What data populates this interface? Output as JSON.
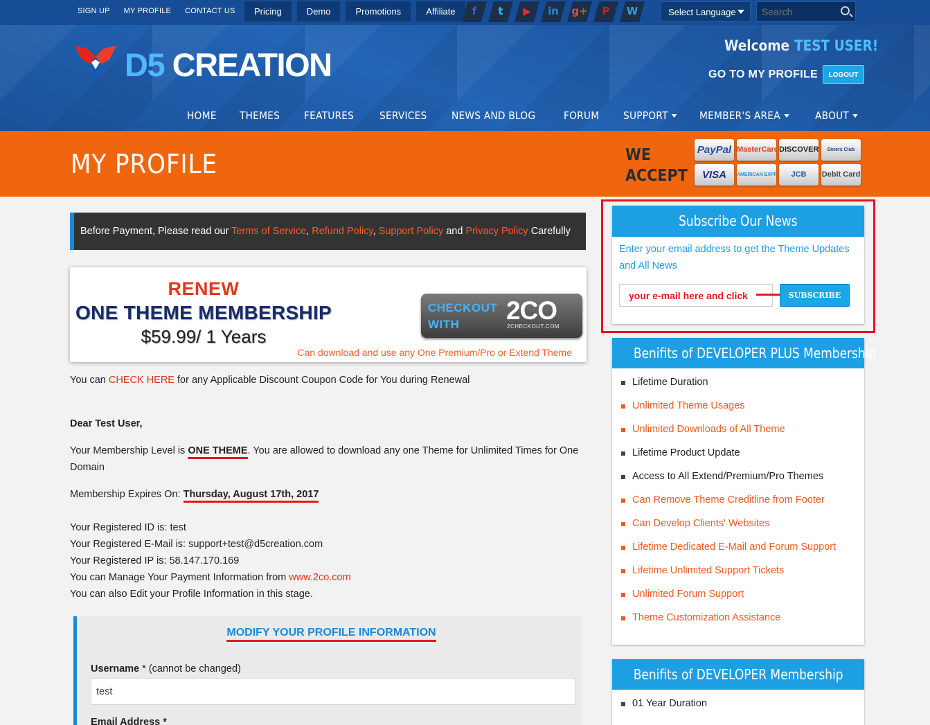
{
  "topbar": {
    "links": [
      "SIGN UP",
      "MY PROFILE",
      "CONTACT US"
    ],
    "buttons": [
      "Pricing",
      "Demo",
      "Promotions",
      "Affiliate"
    ],
    "social": [
      {
        "icon": "facebook-icon",
        "glyph": "f",
        "color": "#3b5ccc"
      },
      {
        "icon": "twitter-icon",
        "glyph": "t",
        "color": "#3fb4f2"
      },
      {
        "icon": "youtube-icon",
        "glyph": "▶",
        "color": "#e52d27"
      },
      {
        "icon": "linkedin-icon",
        "glyph": "in",
        "color": "#2a88c9"
      },
      {
        "icon": "google-plus-icon",
        "glyph": "g+",
        "color": "#dd4b39"
      },
      {
        "icon": "pinterest-icon",
        "glyph": "P",
        "color": "#cb2027"
      },
      {
        "icon": "wordpress-icon",
        "glyph": "W",
        "color": "#3d9ad1"
      }
    ],
    "language_label": "Select Language",
    "search_placeholder": "Search"
  },
  "header": {
    "logo_d5": "D5",
    "logo_creation": "CREATION",
    "welcome": "Welcome",
    "user": "TEST USER!",
    "go_profile": "GO TO MY PROFILE",
    "logout": "LOGOUT",
    "nav": [
      {
        "label": "HOME",
        "dropdown": false
      },
      {
        "label": "THEMES",
        "dropdown": false
      },
      {
        "label": "FEATURES",
        "dropdown": false
      },
      {
        "label": "SERVICES",
        "dropdown": false
      },
      {
        "label": "NEWS AND BLOG",
        "dropdown": false
      },
      {
        "label": "FORUM",
        "dropdown": false
      },
      {
        "label": "SUPPORT",
        "dropdown": true
      },
      {
        "label": "MEMBER'S AREA",
        "dropdown": true
      },
      {
        "label": "ABOUT",
        "dropdown": true
      }
    ]
  },
  "banner": {
    "title": "MY PROFILE",
    "we": "WE",
    "accept": "ACCEPT",
    "cards": [
      {
        "label": "PayPal",
        "color": "#1f4fa0"
      },
      {
        "label": "MasterCard",
        "color": "#e23a1b"
      },
      {
        "label": "DISCOVER",
        "color": "#222222"
      },
      {
        "label": "Diners Club",
        "color": "#1c3d86"
      },
      {
        "label": "VISA",
        "color": "#1a2f8a"
      },
      {
        "label": "AMERICAN EXPRESS",
        "color": "#2c8fd6"
      },
      {
        "label": "JCB",
        "color": "#1d5aa7"
      },
      {
        "label": "Debit Card",
        "color": "#444444"
      }
    ]
  },
  "notice": {
    "prefix": "Before Payment, Please read our ",
    "terms": "Terms of Service",
    "sep1": ", ",
    "refund": "Refund Policy",
    "sep2": ", ",
    "support": "Support Policy",
    "and": " and ",
    "privacy": "Privacy Policy",
    "suffix": " Carefully"
  },
  "renew": {
    "line1": "RENEW",
    "line2": "ONE THEME MEMBERSHIP",
    "line3": "$59.99/ 1 Years",
    "checkout_1": "CHECKOUT",
    "checkout_2": "WITH",
    "checkout_brand": "2CO",
    "checkout_sub": "2CHECKOUT.COM",
    "caption": "Can download and use any One Premium/Pro or Extend Theme"
  },
  "coupon": {
    "prefix": "You can ",
    "link": "CHECK HERE",
    "suffix": " for any Applicable Discount Coupon Code for You during Renewal"
  },
  "profile": {
    "greeting": "Dear Test User,",
    "level_prefix": "Your Membership Level is ",
    "level": "ONE THEME",
    "level_suffix": ". You are allowed to download any one Theme for Unlimited Times for One",
    "level_suffix2": "Domain",
    "expires_prefix": "Membership Expires On: ",
    "expires": "Thursday, August 17th, 2017",
    "reg_id": "Your Registered ID is: test",
    "reg_email": "Your Registered E-Mail is: support+test@d5creation.com",
    "reg_ip": "Your Registered IP is: 58.147.170.169",
    "manage_prefix": "You can Manage Your Payment Information from ",
    "manage_link": "www.2co.com",
    "edit": "You can also Edit your Profile Information in this stage."
  },
  "modify": {
    "heading": "MODIFY YOUR PROFILE INFORMATION",
    "username_label": "Username",
    "username_note": " * (cannot be changed)",
    "username_value": "test",
    "email_label": "Email Address *"
  },
  "subscribe": {
    "heading": "Subscribe Our News",
    "desc": "Enter your email address to get the Theme Updates and All News",
    "placeholder": "your e-mail here and click",
    "button": "SUBSCRIBE"
  },
  "dev_plus": {
    "heading": "Benifits of DEVELOPER PLUS Membership",
    "items": [
      {
        "text": "Lifetime Duration",
        "highlight": false
      },
      {
        "text": "Unlimited Theme Usages",
        "highlight": true
      },
      {
        "text": "Unlimited Downloads of All Theme",
        "highlight": true
      },
      {
        "text": "Lifetime Product Update",
        "highlight": false
      },
      {
        "text": "Access to All Extend/Premium/Pro Themes",
        "highlight": false
      },
      {
        "text": "Can Remove Theme Creditline from Footer",
        "highlight": true
      },
      {
        "text": "Can Develop Clients' Websites",
        "highlight": true
      },
      {
        "text": "Lifetime Dedicated E-Mail and Forum Support",
        "highlight": true
      },
      {
        "text": "Lifetime Unlimited Support Tickets",
        "highlight": true
      },
      {
        "text": "Unlimited Forum Support",
        "highlight": true
      },
      {
        "text": "Theme Customization Assistance",
        "highlight": true
      }
    ]
  },
  "dev": {
    "heading": "Benifits of DEVELOPER Membership",
    "items": [
      {
        "text": "01 Year Duration",
        "highlight": false
      }
    ]
  }
}
